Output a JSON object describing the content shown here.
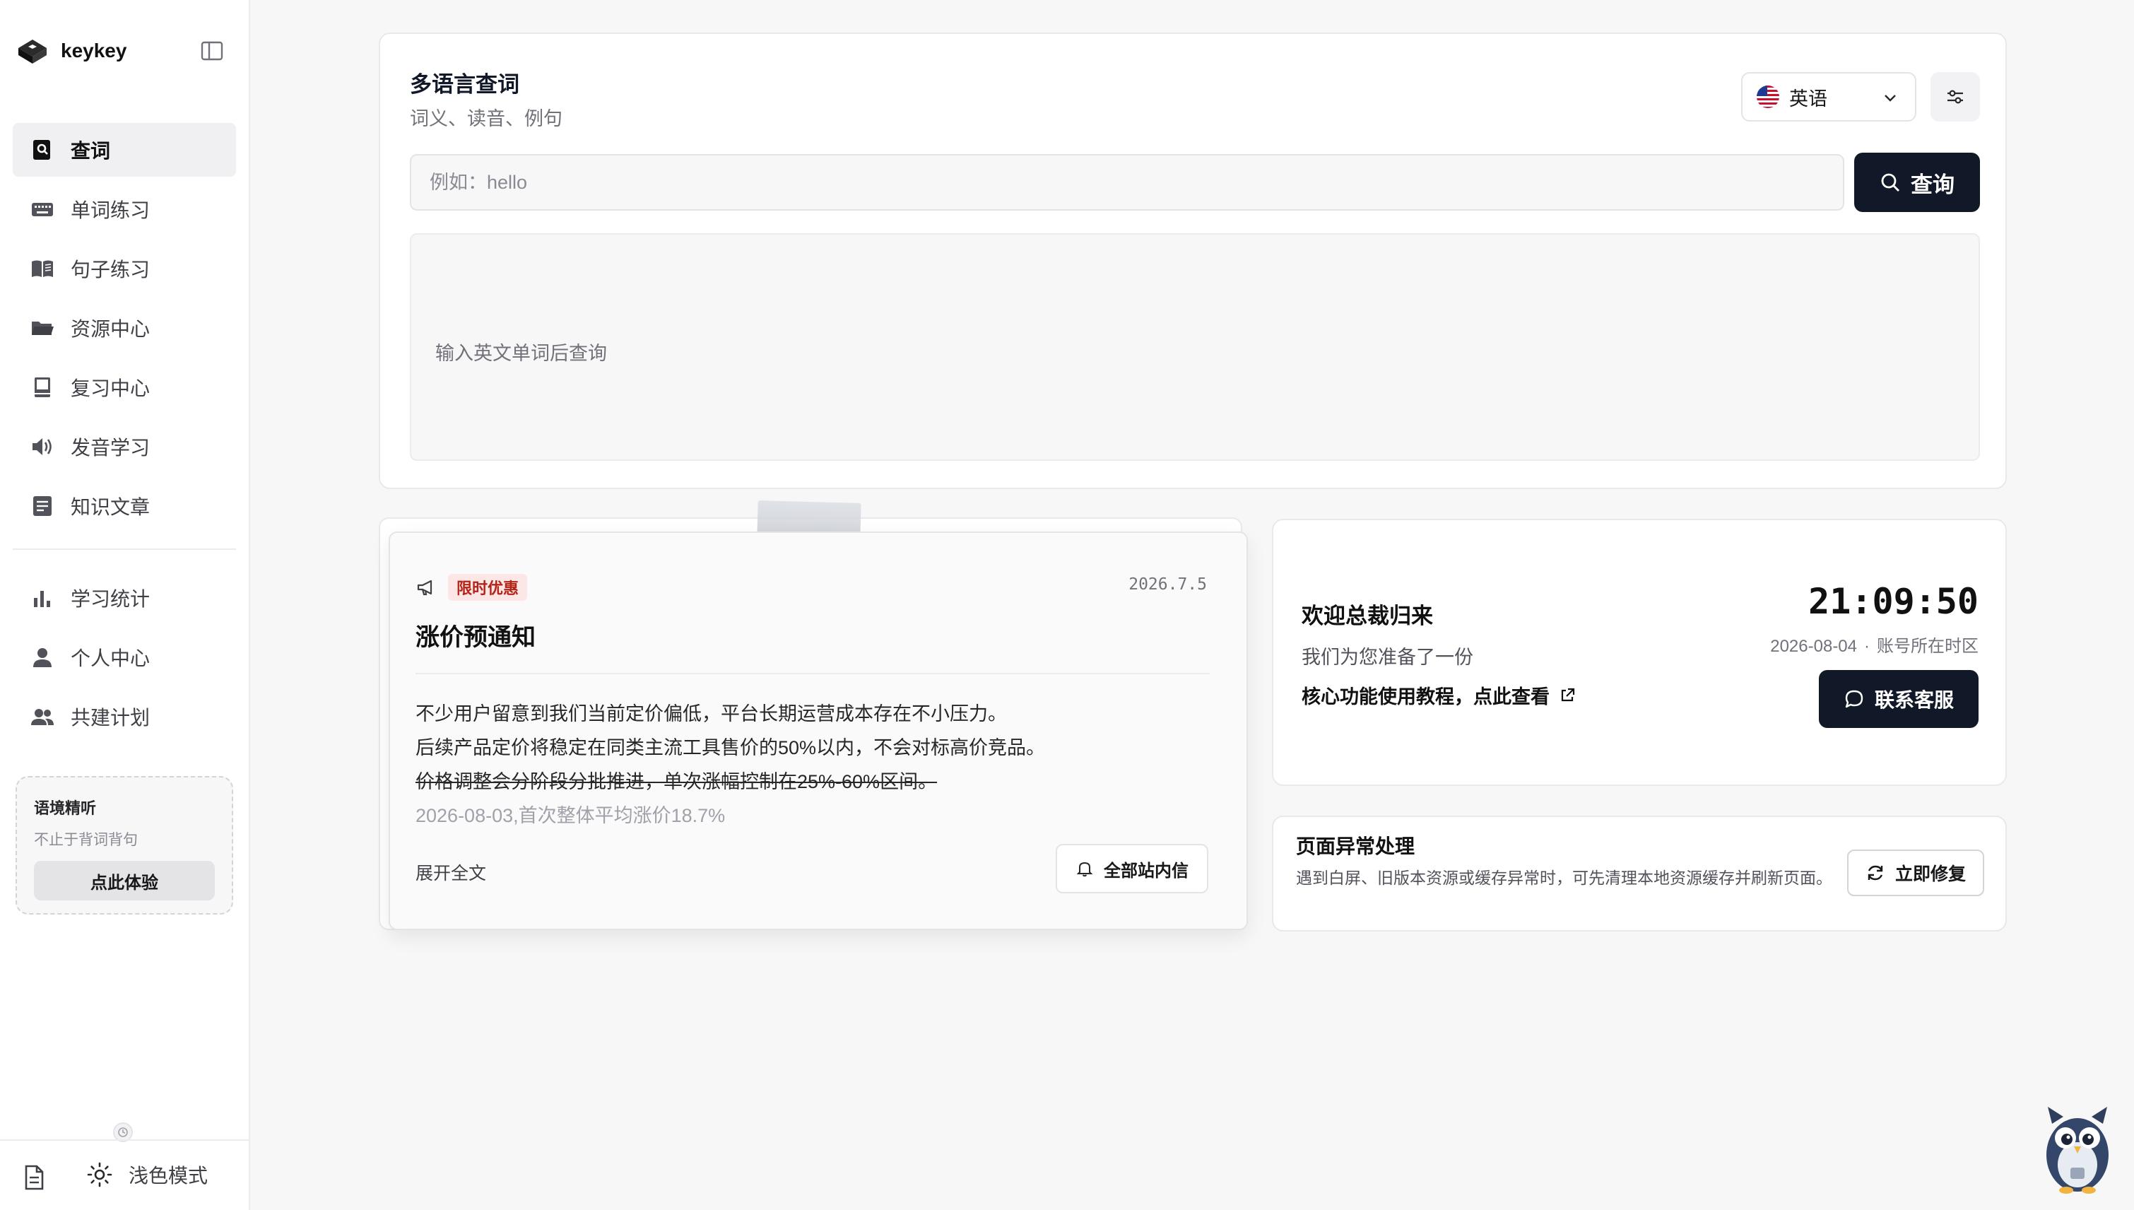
{
  "brand": {
    "name": "keykey"
  },
  "sidebar": {
    "items": [
      {
        "label": "查词",
        "icon": "search-book-icon",
        "active": true
      },
      {
        "label": "单词练习",
        "icon": "keyboard-icon"
      },
      {
        "label": "句子练习",
        "icon": "open-book-icon"
      },
      {
        "label": "资源中心",
        "icon": "folder-icon"
      },
      {
        "label": "复习中心",
        "icon": "book-icon"
      },
      {
        "label": "发音学习",
        "icon": "speaker-icon"
      },
      {
        "label": "知识文章",
        "icon": "article-icon"
      }
    ],
    "items2": [
      {
        "label": "学习统计",
        "icon": "bar-chart-icon"
      },
      {
        "label": "个人中心",
        "icon": "person-icon"
      },
      {
        "label": "共建计划",
        "icon": "group-icon"
      }
    ],
    "promo": {
      "title": "语境精听",
      "subtitle": "不止于背词背句",
      "button": "点此体验"
    },
    "theme_label": "浅色模式"
  },
  "query": {
    "title": "多语言查词",
    "subtitle": "词义、读音、例句",
    "language": "英语",
    "placeholder": "例如：hello",
    "button": "查询",
    "hint": "输入英文单词后查询"
  },
  "notice": {
    "badge": "限时优惠",
    "date": "2026.7.5",
    "title": "涨价预通知",
    "lines": [
      "不少用户留意到我们当前定价偏低，平台长期运营成本存在不小压力。",
      "后续产品定价将稳定在同类主流工具售价的50%以内，不会对标高价竞品。",
      "价格调整会分阶段分批推进，单次涨幅控制在25%-60%区间。",
      "2026-08-03,首次整体平均涨价18.7%"
    ],
    "expand": "展开全文",
    "inbox_button": "全部站内信"
  },
  "welcome": {
    "title": "欢迎总裁归来",
    "subtitle": "我们为您准备了一份",
    "link": "核心功能使用教程，点此查看",
    "clock": "21:09:50",
    "date": "2026-08-04",
    "timezone": "账号所在时区",
    "contact_button": "联系客服"
  },
  "repair": {
    "title": "页面异常处理",
    "desc": "遇到白屏、旧版本资源或缓存异常时，可先清理本地资源缓存并刷新页面。",
    "button": "立即修复"
  },
  "colors": {
    "primary": "#111827",
    "badge_bg": "#fde6e6",
    "badge_text": "#b42318"
  }
}
